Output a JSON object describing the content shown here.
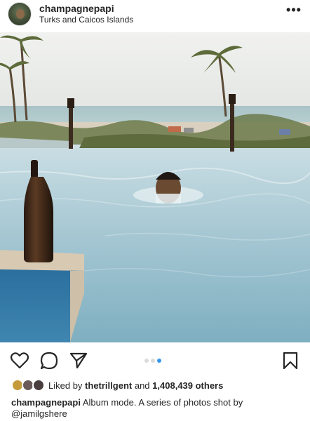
{
  "header": {
    "username": "champagnepapi",
    "location": "Turks and Caicos Islands",
    "more_label": "•••"
  },
  "photo": {
    "carousel_index": 3,
    "carousel_count": 3
  },
  "actions": {
    "like_icon": "heart-icon",
    "comment_icon": "comment-icon",
    "share_icon": "share-icon",
    "save_icon": "bookmark-icon"
  },
  "likes": {
    "prefix": "Liked by",
    "user": "thetrillgent",
    "joiner": "and",
    "count": "1,408,439 others"
  },
  "caption": {
    "username": "champagnepapi",
    "text": "Album mode. A series of photos shot by",
    "mention": "@jamilgshere"
  },
  "colors": {
    "text": "#262626",
    "accent_dot": "#3897f0",
    "inactive_dot": "#dbdbdb"
  }
}
